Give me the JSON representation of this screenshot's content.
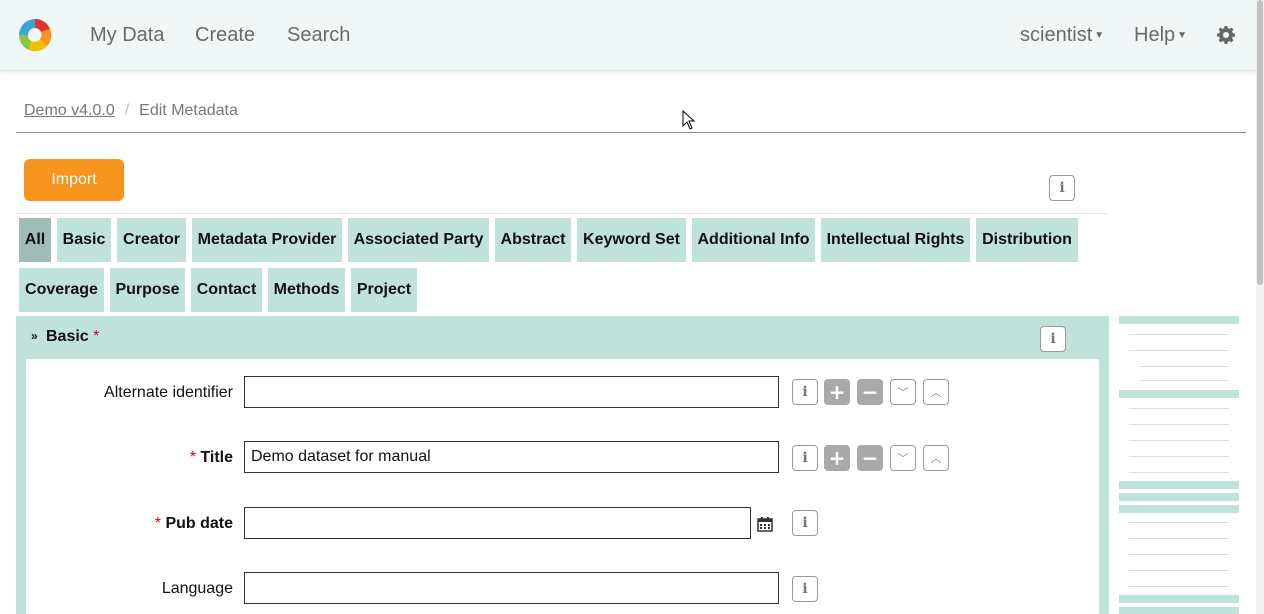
{
  "nav": {
    "links": [
      "My Data",
      "Create",
      "Search"
    ],
    "user": "scientist",
    "help": "Help"
  },
  "breadcrumb": {
    "parent": "Demo v4.0.0",
    "current": "Edit Metadata"
  },
  "import_label": "Import",
  "tabs": [
    "All",
    "Basic",
    "Creator",
    "Metadata Provider",
    "Associated Party",
    "Abstract",
    "Keyword Set",
    "Additional Info",
    "Intellectual Rights",
    "Distribution",
    "Coverage",
    "Purpose",
    "Contact",
    "Methods",
    "Project"
  ],
  "active_tab": "All",
  "section": {
    "title": "Basic",
    "required_mark": "*"
  },
  "fields": {
    "alternate_identifier": {
      "label": "Alternate identifier",
      "value": ""
    },
    "title": {
      "label": "Title",
      "value": "Demo dataset for manual",
      "required_mark": "*"
    },
    "pub_date": {
      "label": "Pub date",
      "value": "",
      "required_mark": "*"
    },
    "language": {
      "label": "Language",
      "value": ""
    }
  },
  "icons": {
    "info": "i",
    "add": "+",
    "remove": "−",
    "down": "chevron-down-icon",
    "up": "chevron-up-icon"
  },
  "colors": {
    "tab_bg": "#bfe2da",
    "tab_active_bg": "#9fbdb6",
    "import_bg": "#f7941d",
    "required": "#d9001b"
  }
}
